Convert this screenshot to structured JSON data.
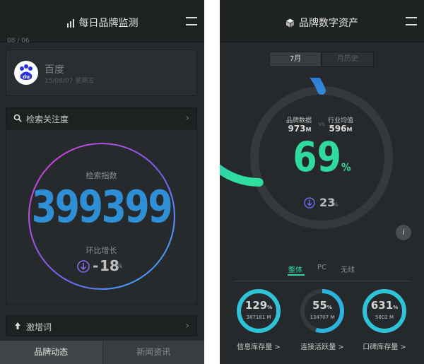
{
  "panel1": {
    "title": "每日品牌监测",
    "date_strip": "08 / 06",
    "brand": {
      "name": "百度",
      "date": "15/08/07",
      "weekday": "星期五",
      "logo_text": "du"
    },
    "search_section": {
      "label": "检索关注度"
    },
    "metric": {
      "label": "检索指数",
      "value": "399399",
      "change_label": "环比增长",
      "change_sign": "-",
      "change_value": "18",
      "change_unit": "%"
    },
    "surge_section": {
      "label": "激增词"
    },
    "tabs": [
      {
        "label": "品牌动态"
      },
      {
        "label": "新闻资讯"
      }
    ]
  },
  "panel2": {
    "title": "品牌数字资产",
    "segments": [
      {
        "label": "7月"
      },
      {
        "label": "月历史"
      }
    ],
    "brand_data": {
      "label": "品牌数据",
      "value": "973",
      "unit": "M"
    },
    "vs": "VS",
    "industry_avg": {
      "label": "行业均值",
      "value": "596",
      "unit": "M"
    },
    "main_pct": {
      "value": "69",
      "unit": "%",
      "fraction": 0.69
    },
    "sub_pct": {
      "value": "23",
      "unit": "%"
    },
    "info": "i",
    "device_tabs": [
      {
        "label": "整体"
      },
      {
        "label": "PC"
      },
      {
        "label": "无线"
      }
    ],
    "minis": [
      {
        "pct": "129",
        "unit": "%",
        "sub": "387181",
        "sub_unit": "M",
        "caption": "信息库存量 >",
        "fraction": 1.0
      },
      {
        "pct": "55",
        "unit": "%",
        "sub": "134707",
        "sub_unit": "M",
        "caption": "连接活跃量 >",
        "fraction": 0.55
      },
      {
        "pct": "631",
        "unit": "%",
        "sub": "5802",
        "sub_unit": "M",
        "caption": "口碑库存量 >",
        "fraction": 1.0
      }
    ]
  },
  "colors": {
    "blue_number": "#2f8fd6",
    "teal_accent": "#30d9a0",
    "ring_gradient_start": "#e03cd6",
    "ring_gradient_end": "#2fb8ff"
  }
}
